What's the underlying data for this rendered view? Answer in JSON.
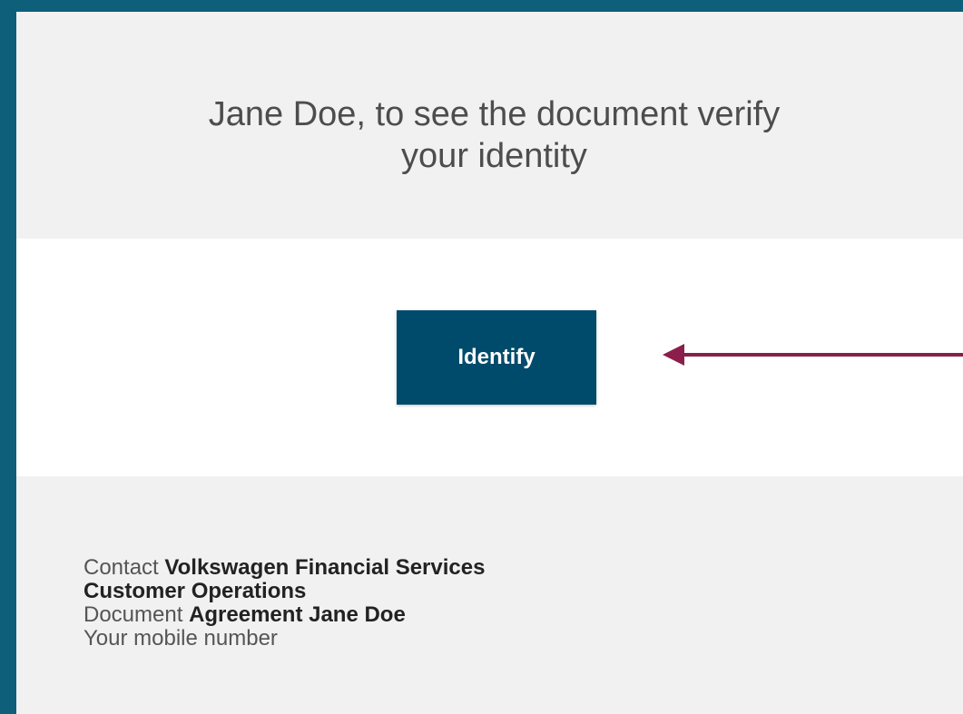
{
  "header": {
    "title_line1": "Jane Doe, to see the document verify",
    "title_line2": "your identity"
  },
  "main": {
    "identify_label": "Identify",
    "arrow_color": "#8b1e4b"
  },
  "footer": {
    "contact_label": "Contact",
    "contact_value_line1": "Volkswagen Financial Services",
    "contact_value_line2": "Customer Operations",
    "document_label": "Document",
    "document_value": "Agreement Jane Doe",
    "mobile_label": "Your mobile number"
  },
  "colors": {
    "frame_border": "#0e5f79",
    "button_bg": "#004b6b",
    "panel_bg": "#f1f1f1"
  },
  "icons": {
    "pointer": "left-arrow-icon"
  }
}
